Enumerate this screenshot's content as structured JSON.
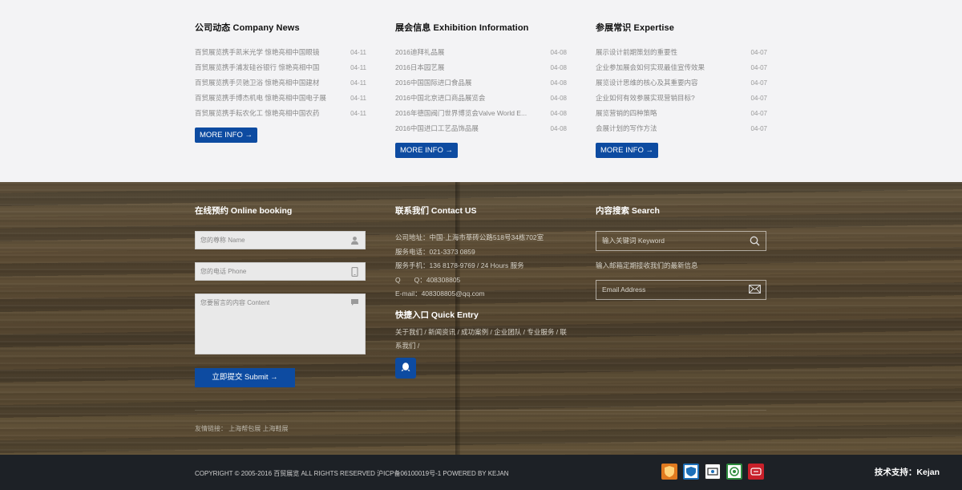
{
  "news": {
    "company": {
      "title": "公司动态 Company News",
      "items": [
        {
          "text": "百贸展览携手凯米光学 惊艳亮相中国眼镜",
          "date": "04-11"
        },
        {
          "text": "百贸展览携手浦发硅谷银行 惊艳亮相中国",
          "date": "04-11"
        },
        {
          "text": "百贸展览携手贝驰卫浴 惊艳亮相中国建材",
          "date": "04-11"
        },
        {
          "text": "百贸展览携手博杰机电 惊艳亮相中国电子展",
          "date": "04-11"
        },
        {
          "text": "百贸展览携手耘农化工 惊艳亮相中国农药",
          "date": "04-11"
        }
      ],
      "more": "MORE INFO →"
    },
    "exhibition": {
      "title": "展会信息 Exhibition Information",
      "items": [
        {
          "text": "2016迪拜礼品展",
          "date": "04-08"
        },
        {
          "text": "2016日本园艺展",
          "date": "04-08"
        },
        {
          "text": "2016中国国际进口食品展",
          "date": "04-08"
        },
        {
          "text": "2016中国北京进口商品展览会",
          "date": "04-08"
        },
        {
          "text": "2016年德国阀门世界博览会Valve World E...",
          "date": "04-08"
        },
        {
          "text": "2016中国进口工艺品饰品展",
          "date": "04-08"
        }
      ],
      "more": "MORE INFO →"
    },
    "expertise": {
      "title": "参展常识 Expertise",
      "items": [
        {
          "text": "展示设计前期策划的重要性",
          "date": "04-07"
        },
        {
          "text": "企业参加展会如何实现最佳宣传效果",
          "date": "04-07"
        },
        {
          "text": "展览设计思维的核心及其重要内容",
          "date": "04-07"
        },
        {
          "text": "企业如何有效参展实现营销目标?",
          "date": "04-07"
        },
        {
          "text": "展览营销的四种策略",
          "date": "04-07"
        },
        {
          "text": "会展计划的写作方法",
          "date": "04-07"
        }
      ],
      "more": "MORE INFO →"
    }
  },
  "booking": {
    "title": "在线预约 Online booking",
    "name_placeholder": "您的尊称 Name",
    "phone_placeholder": "您的电话 Phone",
    "content_placeholder": "您要留言的内容 Content",
    "submit": "立即提交 Submit →"
  },
  "contact": {
    "title": "联系我们 Contact US",
    "lines": [
      "公司地址：中国·上海市莘砖公路518号34栋702室",
      "服务电话：021-3373 0859",
      "服务手机：136 8178-9769 / 24 Hours 服务",
      "Q　　Q：408308805",
      "E-mail：408308805@qq.com"
    ],
    "quick_title": "快捷入口 Quick Entry",
    "quick_links": "关于我们 / 新闻资讯 / 成功案例 / 企业团队 / 专业服务 / 联系我们 /"
  },
  "search": {
    "title": "内容搜索 Search",
    "keyword_placeholder": "输入关键词 Keyword",
    "subscribe_text": "输入邮箱定期接收我们的最新信息",
    "email_placeholder": "Email Address"
  },
  "friends": "友情链接：  上海帮包展  上海鞋展",
  "footer": {
    "copyright": "COPYRIGHT © 2005-2016 百贸展览 ALL RIGHTS RESERVED 沪ICP备06100019号-1 POWERED BY KEJAN",
    "tech_support": "技术支持：Kejan",
    "badges": [
      {
        "icon": "shield-badge-icon",
        "color": "#e07a1f"
      },
      {
        "icon": "police-badge-icon",
        "color": "#1d6fb8"
      },
      {
        "icon": "trust-badge-icon",
        "color": "#2a2a2a"
      },
      {
        "icon": "green-cert-icon",
        "color": "#2e8b3d"
      },
      {
        "icon": "red-cert-icon",
        "color": "#c8202a"
      }
    ]
  }
}
